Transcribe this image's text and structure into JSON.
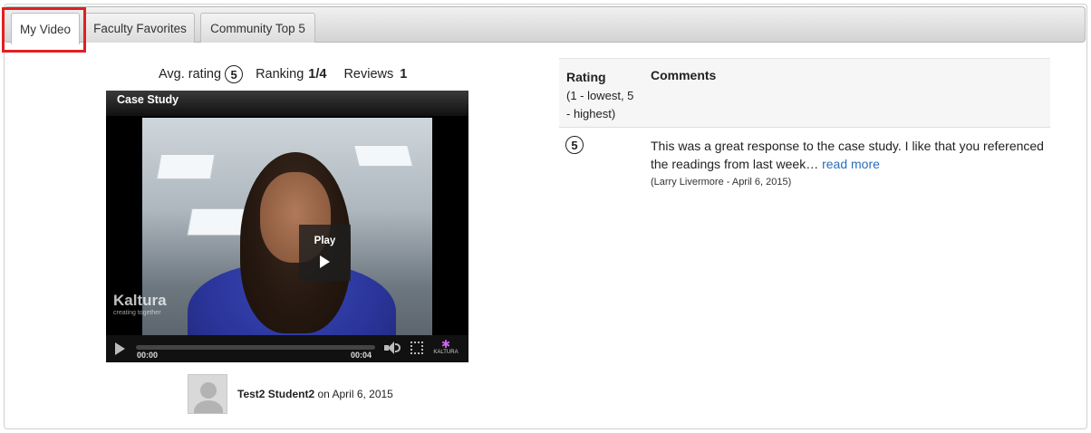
{
  "tabs": [
    {
      "label": "My Video",
      "active": true
    },
    {
      "label": "Faculty Favorites",
      "active": false
    },
    {
      "label": "Community Top 5",
      "active": false
    }
  ],
  "stats": {
    "avg_rating_label": "Avg. rating",
    "avg_rating_value": "5",
    "ranking_label": "Ranking",
    "ranking_value": "1/4",
    "reviews_label": "Reviews",
    "reviews_value": "1"
  },
  "player": {
    "title": "Case Study",
    "play_label": "Play",
    "current_time": "00:00",
    "duration": "00:04",
    "watermark_brand": "Kaltura",
    "watermark_tagline": "creating together",
    "logo_text": "KALTURA"
  },
  "author": {
    "name": "Test2 Student2",
    "date_text": " on April 6, 2015"
  },
  "comments_table": {
    "rating_header": "Rating",
    "rating_subheader": "(1 - lowest, 5 - highest)",
    "comments_header": "Comments",
    "rows": [
      {
        "rating": "5",
        "text": "This was a great response to the case study. I like that you referenced the readings from last week…",
        "read_more": "read more",
        "meta": "(Larry Livermore - April 6, 2015)"
      }
    ]
  },
  "colors": {
    "highlight": "#e02020",
    "link": "#2a6ebb"
  }
}
